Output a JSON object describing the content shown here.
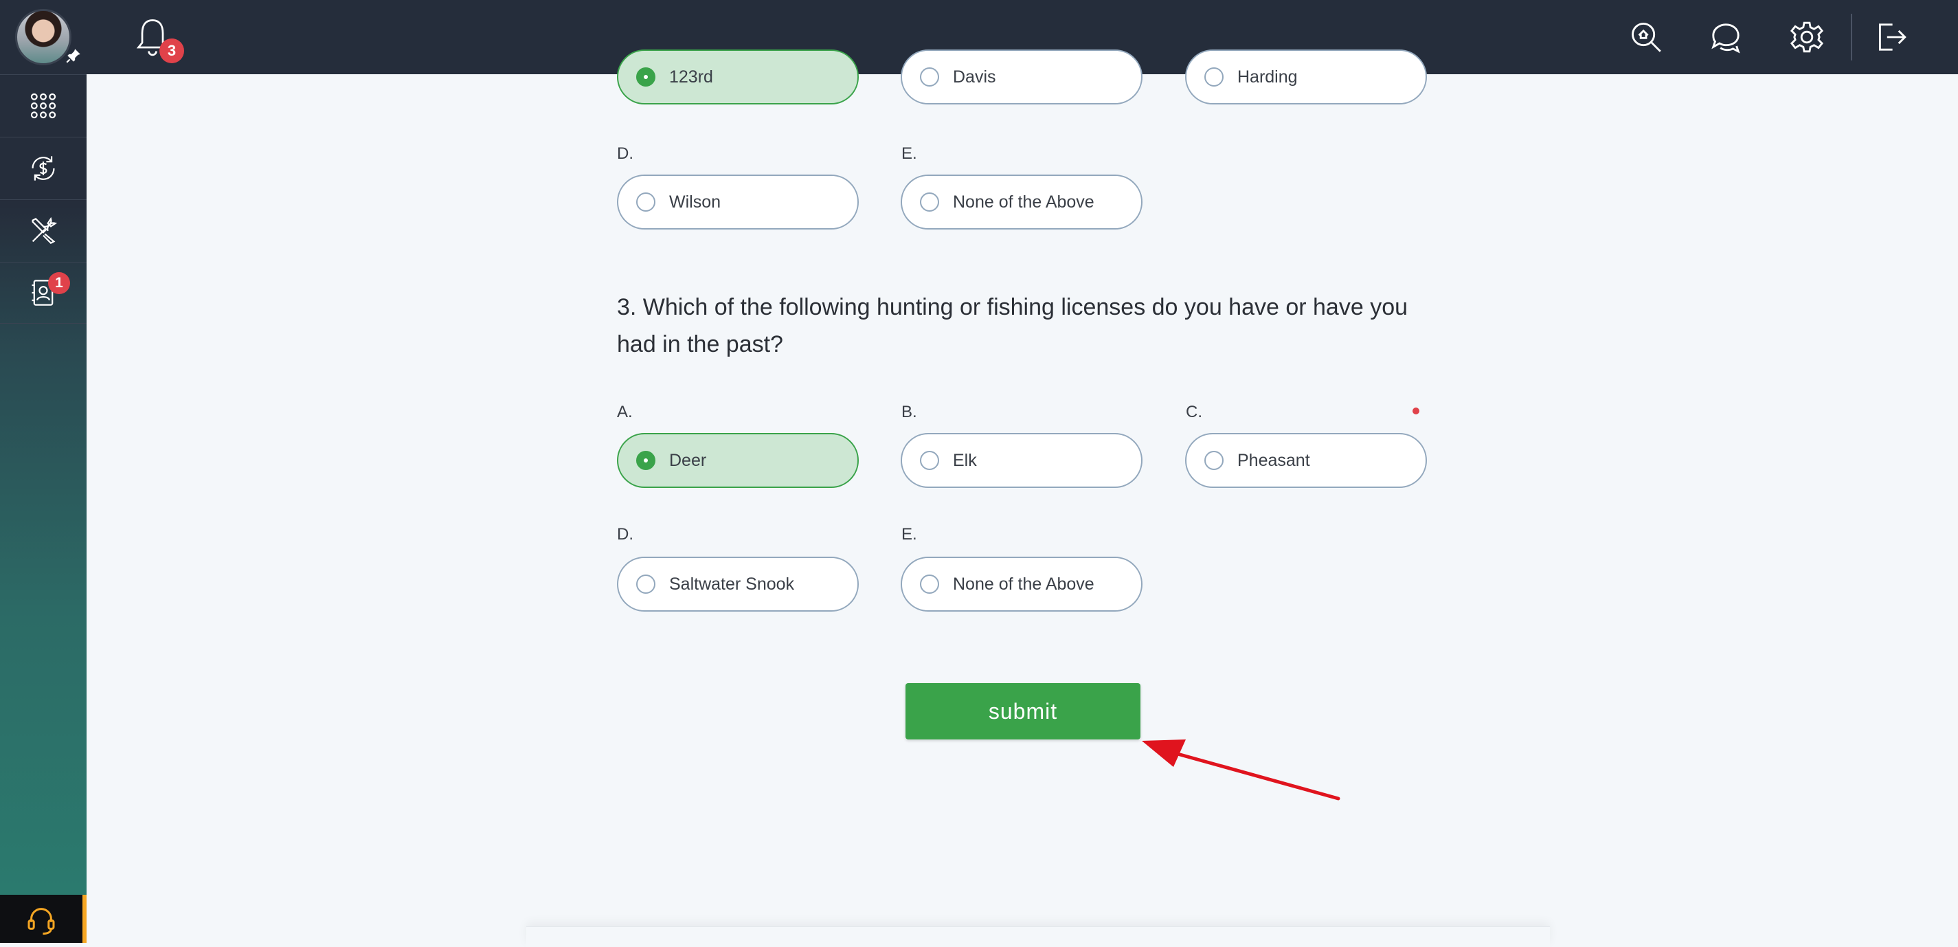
{
  "topbar": {
    "notifications_count": "3",
    "icons": [
      "search-icon",
      "chat-icon",
      "gear-icon",
      "logout-icon"
    ]
  },
  "sidebar": {
    "items": [
      {
        "name": "apps-grid",
        "icon": "grid-icon"
      },
      {
        "name": "payments",
        "icon": "dollar-refresh-icon"
      },
      {
        "name": "tools",
        "icon": "tools-icon"
      },
      {
        "name": "profile",
        "icon": "contact-card-icon",
        "badge": "1"
      }
    ],
    "support_icon": "headset-icon"
  },
  "question2": {
    "row1": [
      {
        "letter": "",
        "label": "123rd",
        "selected": true
      },
      {
        "letter": "",
        "label": "Davis",
        "selected": false
      },
      {
        "letter": "",
        "label": "Harding",
        "selected": false
      }
    ],
    "row2": [
      {
        "letter": "D.",
        "label": "Wilson",
        "selected": false
      },
      {
        "letter": "E.",
        "label": "None of the Above",
        "selected": false
      }
    ]
  },
  "question3": {
    "text": "3. Which of the following hunting or fishing licenses do you have or have you had in the past?",
    "row1": [
      {
        "letter": "A.",
        "label": "Deer",
        "selected": true
      },
      {
        "letter": "B.",
        "label": "Elk",
        "selected": false
      },
      {
        "letter": "C.",
        "label": "Pheasant",
        "selected": false
      }
    ],
    "row2": [
      {
        "letter": "D.",
        "label": "Saltwater Snook",
        "selected": false
      },
      {
        "letter": "E.",
        "label": "None of the Above",
        "selected": false
      }
    ]
  },
  "submit_label": "submit",
  "colors": {
    "primary_green": "#3aa34a",
    "selected_bg": "#cde7d3",
    "badge_red": "#e0424a",
    "topbar": "#252d3b",
    "annotation_arrow": "#e0141e"
  }
}
